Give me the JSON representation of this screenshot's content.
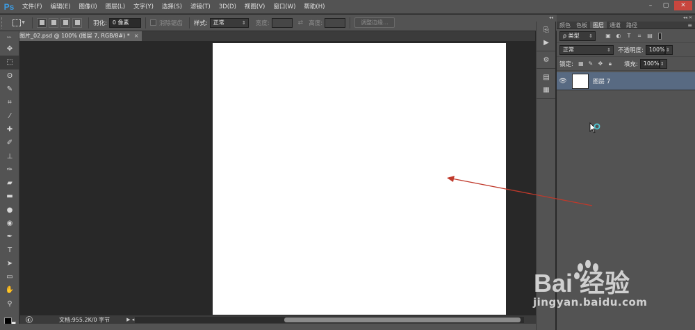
{
  "app": {
    "logo": "Ps",
    "menu": [
      "文件(F)",
      "编辑(E)",
      "图像(I)",
      "图层(L)",
      "文字(Y)",
      "选择(S)",
      "滤镜(T)",
      "3D(D)",
      "视图(V)",
      "窗口(W)",
      "帮助(H)"
    ],
    "window_controls": [
      "–",
      "▢",
      "✕"
    ]
  },
  "options_bar": {
    "feather_label": "羽化:",
    "feather_value": "0 像素",
    "antialias_label": "消除锯齿",
    "style_label": "样式:",
    "style_value": "正常",
    "width_label": "宽度:",
    "height_label": "高度:",
    "refine_edge_button": "调整边缘..."
  },
  "document": {
    "tab_title": "图片_02.psd @ 100% (图层 7, RGB/8#) *",
    "tab_close": "×",
    "status_text": "文档:955.2K/0 字节"
  },
  "layers_panel": {
    "tabs": [
      "颜色",
      "色板",
      "图层",
      "通道",
      "路径"
    ],
    "active_tab": "图层",
    "filter_label": "ρ 类型",
    "blend_mode": "正常",
    "opacity_label": "不透明度:",
    "opacity_value": "100%",
    "lock_label": "锁定:",
    "fill_label": "填充:",
    "fill_value": "100%",
    "layers": [
      {
        "name": "图层 7",
        "visible": true,
        "selected": true
      }
    ]
  },
  "colors": {
    "accent_blue": "#3c9ce3",
    "selected_layer": "#586a82",
    "annotation_arrow": "#c0392b",
    "close_button": "#c8463e"
  },
  "watermark": {
    "brand": "Bai 经验",
    "url": "jingyan.baidu.com"
  }
}
